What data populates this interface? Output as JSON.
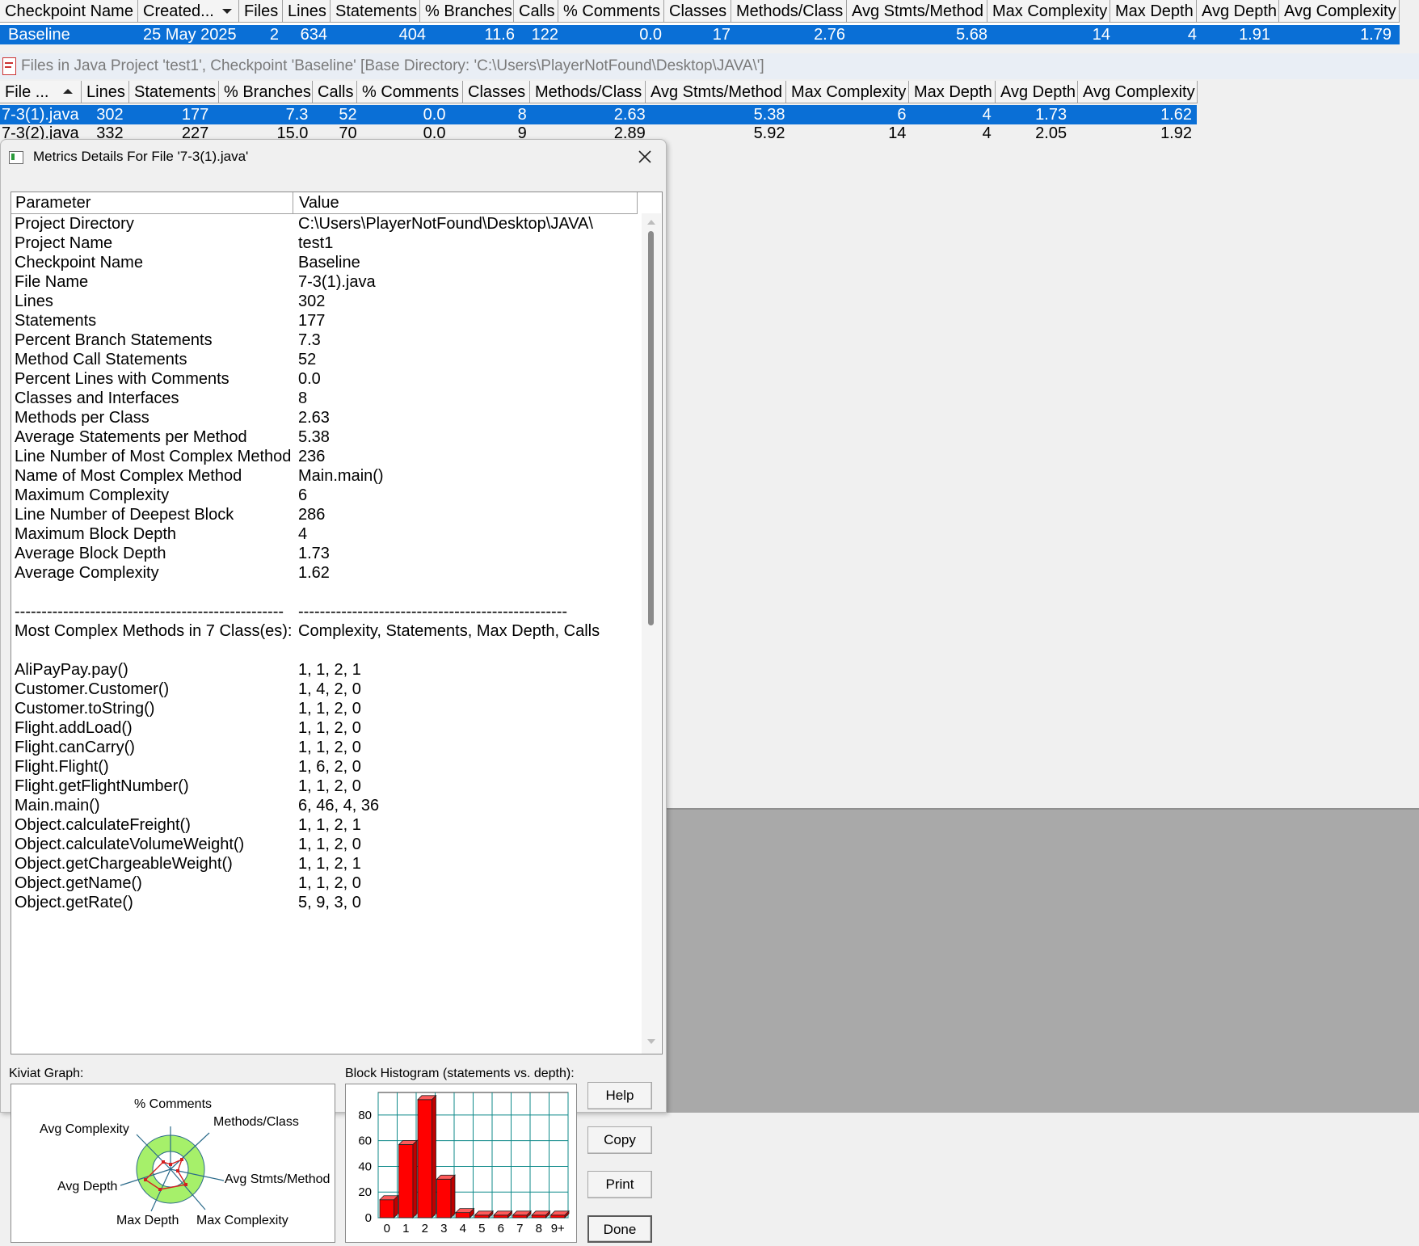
{
  "checkpoints": {
    "columns": [
      "Checkpoint Name",
      "Created...",
      "Files",
      "Lines",
      "Statements",
      "% Branches",
      "Calls",
      "% Comments",
      "Classes",
      "Methods/Class",
      "Avg Stmts/Method",
      "Max Complexity",
      "Max Depth",
      "Avg Depth",
      "Avg Complexity"
    ],
    "rows": [
      [
        "Baseline",
        "25 May 2025",
        "2",
        "634",
        "404",
        "11.6",
        "122",
        "0.0",
        "17",
        "2.76",
        "5.68",
        "14",
        "4",
        "1.91",
        "1.79"
      ]
    ]
  },
  "caption": "Files in Java Project 'test1', Checkpoint 'Baseline'  [Base Directory: 'C:\\Users\\PlayerNotFound\\Desktop\\JAVA\\']",
  "files": {
    "columns": [
      "File ...",
      "Lines",
      "Statements",
      "% Branches",
      "Calls",
      "% Comments",
      "Classes",
      "Methods/Class",
      "Avg Stmts/Method",
      "Max Complexity",
      "Max Depth",
      "Avg Depth",
      "Avg Complexity"
    ],
    "rows": [
      [
        "7-3(1).java",
        "302",
        "177",
        "7.3",
        "52",
        "0.0",
        "8",
        "2.63",
        "5.38",
        "6",
        "4",
        "1.73",
        "1.62"
      ],
      [
        "7-3(2).java",
        "332",
        "227",
        "15.0",
        "70",
        "0.0",
        "9",
        "2.89",
        "5.92",
        "14",
        "4",
        "2.05",
        "1.92"
      ]
    ]
  },
  "dialog": {
    "title": "Metrics Details For File '7-3(1).java'",
    "col_parameter": "Parameter",
    "col_value": "Value",
    "rows": [
      [
        "Project Directory",
        "C:\\Users\\PlayerNotFound\\Desktop\\JAVA\\"
      ],
      [
        "Project Name",
        "test1"
      ],
      [
        "Checkpoint Name",
        "Baseline"
      ],
      [
        "File Name",
        "7-3(1).java"
      ],
      [
        "Lines",
        "302"
      ],
      [
        "Statements",
        "177"
      ],
      [
        "Percent Branch Statements",
        "7.3"
      ],
      [
        "Method Call Statements",
        "52"
      ],
      [
        "Percent Lines with Comments",
        "0.0"
      ],
      [
        "Classes and Interfaces",
        "8"
      ],
      [
        "Methods per Class",
        "2.63"
      ],
      [
        "Average Statements per Method",
        "5.38"
      ],
      [
        "Line Number of Most Complex Method",
        "236"
      ],
      [
        "Name of Most Complex Method",
        "Main.main()"
      ],
      [
        "Maximum Complexity",
        "6"
      ],
      [
        "Line Number of Deepest Block",
        "286"
      ],
      [
        "Maximum Block Depth",
        "4"
      ],
      [
        "Average Block Depth",
        "1.73"
      ],
      [
        "Average Complexity",
        "1.62"
      ],
      [
        "",
        ""
      ],
      [
        "--------------------------------------------------",
        "--------------------------------------------------"
      ],
      [
        "Most Complex Methods in 7 Class(es):",
        "Complexity, Statements, Max Depth, Calls"
      ],
      [
        "",
        ""
      ],
      [
        "AliPayPay.pay()",
        "1, 1, 2, 1"
      ],
      [
        "Customer.Customer()",
        "1, 4, 2, 0"
      ],
      [
        "Customer.toString()",
        "1, 1, 2, 0"
      ],
      [
        "Flight.addLoad()",
        "1, 1, 2, 0"
      ],
      [
        "Flight.canCarry()",
        "1, 1, 2, 0"
      ],
      [
        "Flight.Flight()",
        "1, 6, 2, 0"
      ],
      [
        "Flight.getFlightNumber()",
        "1, 1, 2, 0"
      ],
      [
        "Main.main()",
        "6, 46, 4, 36"
      ],
      [
        "Object.calculateFreight()",
        "1, 1, 2, 1"
      ],
      [
        "Object.calculateVolumeWeight()",
        "1, 1, 2, 0"
      ],
      [
        "Object.getChargeableWeight()",
        "1, 1, 2, 1"
      ],
      [
        "Object.getName()",
        "1, 1, 2, 0"
      ],
      [
        "Object.getRate()",
        "5, 9, 3, 0"
      ]
    ],
    "kiviat_label": "Kiviat Graph:",
    "kiviat_axes": [
      "% Comments",
      "Methods/Class",
      "Avg Stmts/Method",
      "Max Complexity",
      "Max Depth",
      "Avg Depth",
      "Avg Complexity"
    ],
    "histogram_label": "Block Histogram (statements vs. depth):",
    "buttons": {
      "help": "Help",
      "copy": "Copy",
      "print": "Print",
      "done": "Done"
    }
  },
  "chart_data": {
    "type": "bar",
    "title": "Block Histogram (statements vs. depth):",
    "categories": [
      "0",
      "1",
      "2",
      "3",
      "4",
      "5",
      "6",
      "7",
      "8",
      "9+"
    ],
    "values": [
      14,
      57,
      92,
      30,
      4,
      2,
      2,
      2,
      2,
      2
    ],
    "ylim": [
      0,
      90
    ],
    "yticks": [
      "0",
      "20",
      "40",
      "60",
      "80"
    ],
    "grid": true,
    "bar_color": "#ff0000",
    "background": "#ffffff",
    "grid_color": "#0f8a8a"
  },
  "colors": {
    "selection": "#0a6fd6",
    "kiviat_green": "#a6f06a",
    "workspace_gray": "#a9a9a9"
  }
}
